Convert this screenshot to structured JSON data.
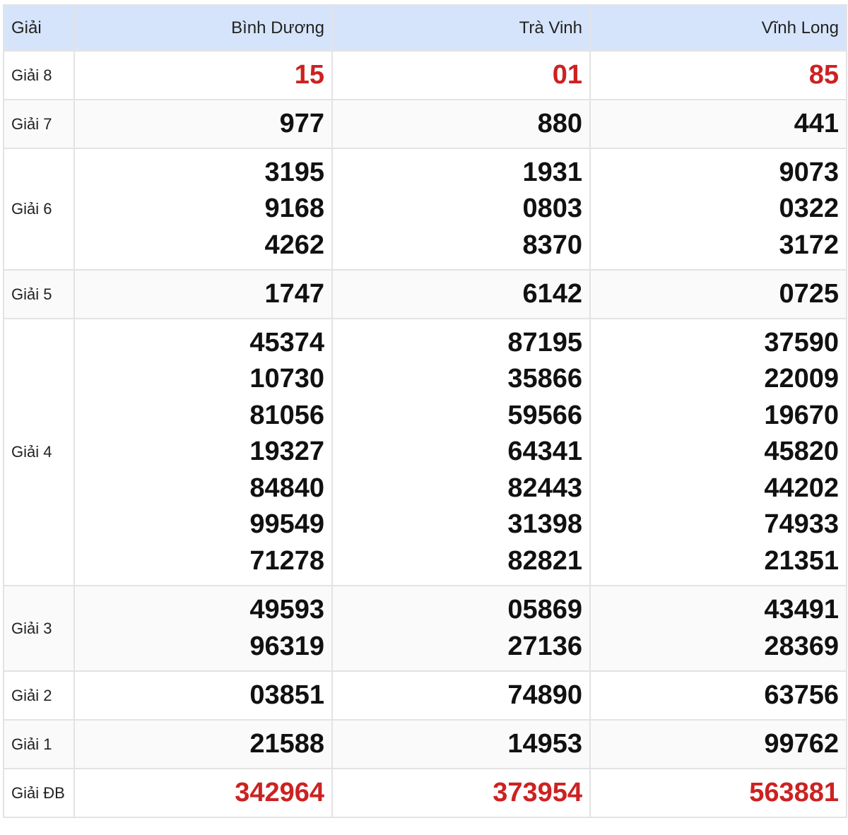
{
  "header": {
    "label": "Giải",
    "provinces": [
      "Bình Dương",
      "Trà Vinh",
      "Vĩnh Long"
    ]
  },
  "prizes": [
    {
      "label": "Giải 8",
      "highlight": true,
      "results": [
        [
          "15"
        ],
        [
          "01"
        ],
        [
          "85"
        ]
      ]
    },
    {
      "label": "Giải 7",
      "highlight": false,
      "results": [
        [
          "977"
        ],
        [
          "880"
        ],
        [
          "441"
        ]
      ]
    },
    {
      "label": "Giải 6",
      "highlight": false,
      "results": [
        [
          "3195",
          "9168",
          "4262"
        ],
        [
          "1931",
          "0803",
          "8370"
        ],
        [
          "9073",
          "0322",
          "3172"
        ]
      ]
    },
    {
      "label": "Giải 5",
      "highlight": false,
      "results": [
        [
          "1747"
        ],
        [
          "6142"
        ],
        [
          "0725"
        ]
      ]
    },
    {
      "label": "Giải 4",
      "highlight": false,
      "results": [
        [
          "45374",
          "10730",
          "81056",
          "19327",
          "84840",
          "99549",
          "71278"
        ],
        [
          "87195",
          "35866",
          "59566",
          "64341",
          "82443",
          "31398",
          "82821"
        ],
        [
          "37590",
          "22009",
          "19670",
          "45820",
          "44202",
          "74933",
          "21351"
        ]
      ]
    },
    {
      "label": "Giải 3",
      "highlight": false,
      "results": [
        [
          "49593",
          "96319"
        ],
        [
          "05869",
          "27136"
        ],
        [
          "43491",
          "28369"
        ]
      ]
    },
    {
      "label": "Giải 2",
      "highlight": false,
      "results": [
        [
          "03851"
        ],
        [
          "74890"
        ],
        [
          "63756"
        ]
      ]
    },
    {
      "label": "Giải 1",
      "highlight": false,
      "results": [
        [
          "21588"
        ],
        [
          "14953"
        ],
        [
          "99762"
        ]
      ]
    },
    {
      "label": "Giải ĐB",
      "highlight": true,
      "results": [
        [
          "342964"
        ],
        [
          "373954"
        ],
        [
          "563881"
        ]
      ]
    }
  ],
  "colors": {
    "header_bg": "#d6e4fb",
    "highlight": "#cc2222",
    "text": "#111111"
  }
}
